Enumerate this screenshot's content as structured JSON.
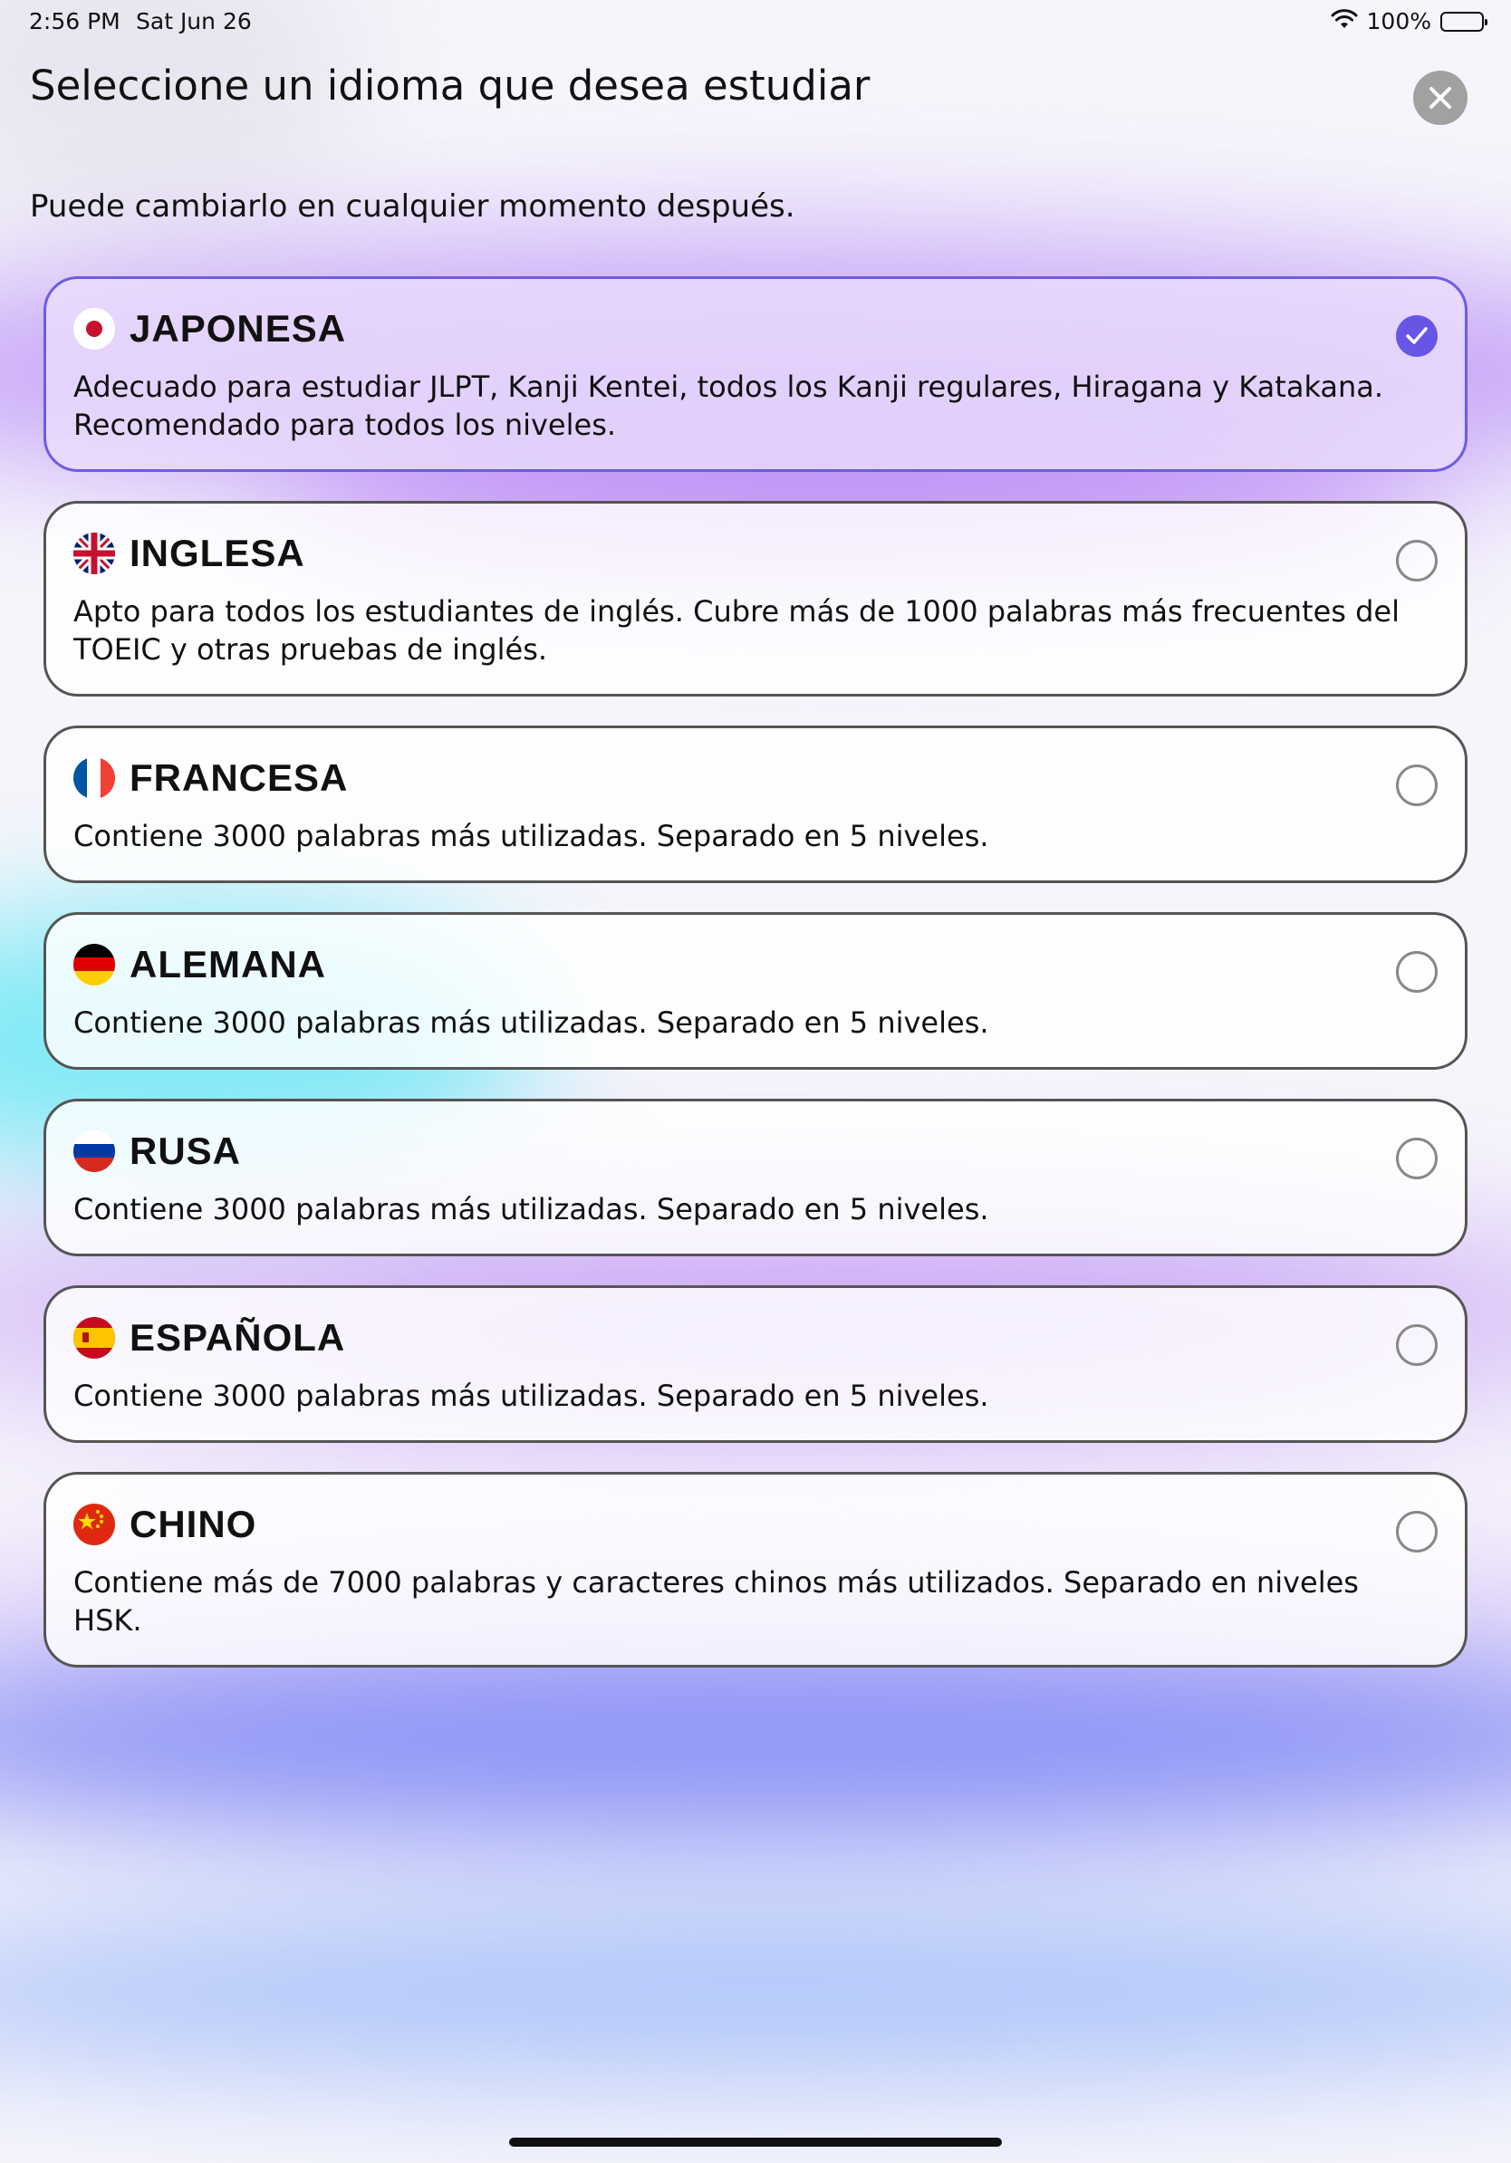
{
  "status_bar": {
    "time": "2:56 PM",
    "date": "Sat Jun 26",
    "battery": "100%"
  },
  "header": {
    "title": "Seleccione un idioma que desea estudiar",
    "subtitle": "Puede cambiarlo en cualquier momento después."
  },
  "accent_color": "#6756e6",
  "languages": [
    {
      "name": "JAPONESA",
      "flag_icon": "japan-flag-icon",
      "selected": true,
      "description": "Adecuado para estudiar JLPT, Kanji Kentei, todos los Kanji regulares, Hiragana y Katakana.\nRecomendado para todos los niveles."
    },
    {
      "name": "INGLESA",
      "flag_icon": "uk-flag-icon",
      "selected": false,
      "description": "Apto para todos los estudiantes de inglés. Cubre más de 1000 palabras más frecuentes del TOEIC y otras pruebas de inglés."
    },
    {
      "name": "FRANCESA",
      "flag_icon": "france-flag-icon",
      "selected": false,
      "description": "Contiene 3000 palabras más utilizadas. Separado en 5 niveles."
    },
    {
      "name": "ALEMANA",
      "flag_icon": "germany-flag-icon",
      "selected": false,
      "description": "Contiene 3000 palabras más utilizadas. Separado en 5 niveles."
    },
    {
      "name": "RUSA",
      "flag_icon": "russia-flag-icon",
      "selected": false,
      "description": "Contiene 3000 palabras más utilizadas. Separado en 5 niveles."
    },
    {
      "name": "ESPAÑOLA",
      "flag_icon": "spain-flag-icon",
      "selected": false,
      "description": "Contiene 3000 palabras más utilizadas. Separado en 5 niveles."
    },
    {
      "name": "CHINO",
      "flag_icon": "china-flag-icon",
      "selected": false,
      "description": "Contiene más de 7000 palabras y caracteres chinos más utilizados. Separado en niveles HSK."
    }
  ]
}
